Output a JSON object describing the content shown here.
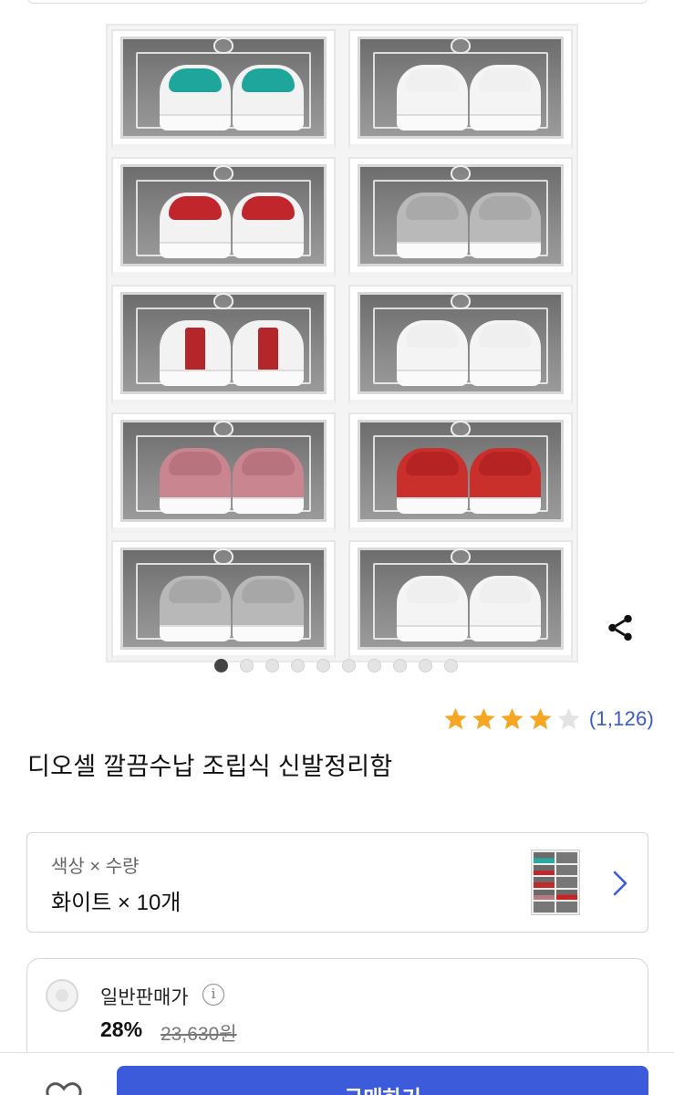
{
  "product": {
    "name": "디오셀 깔끔수납 조립식 신발정리함",
    "rating": 4,
    "rating_max": 5,
    "review_count": "(1,126)"
  },
  "gallery": {
    "image_count": 10,
    "active_index": 0
  },
  "option": {
    "label": "색상 × 수량",
    "value": "화이트 × 10개"
  },
  "price": {
    "type_label": "일반판매가",
    "info_symbol": "i",
    "discount": "28%",
    "original_price": "23,630원"
  },
  "actions": {
    "buy_label": "구매하기"
  },
  "icons": {
    "share": "share-icon",
    "star": "star-icon",
    "chevron": "chevron-right-icon",
    "info": "info-icon",
    "heart": "heart-icon"
  },
  "colors": {
    "accent": "#3b5bdb",
    "star": "#f5a623",
    "star_empty": "#e3e3e3",
    "link": "#3a5bc7"
  }
}
